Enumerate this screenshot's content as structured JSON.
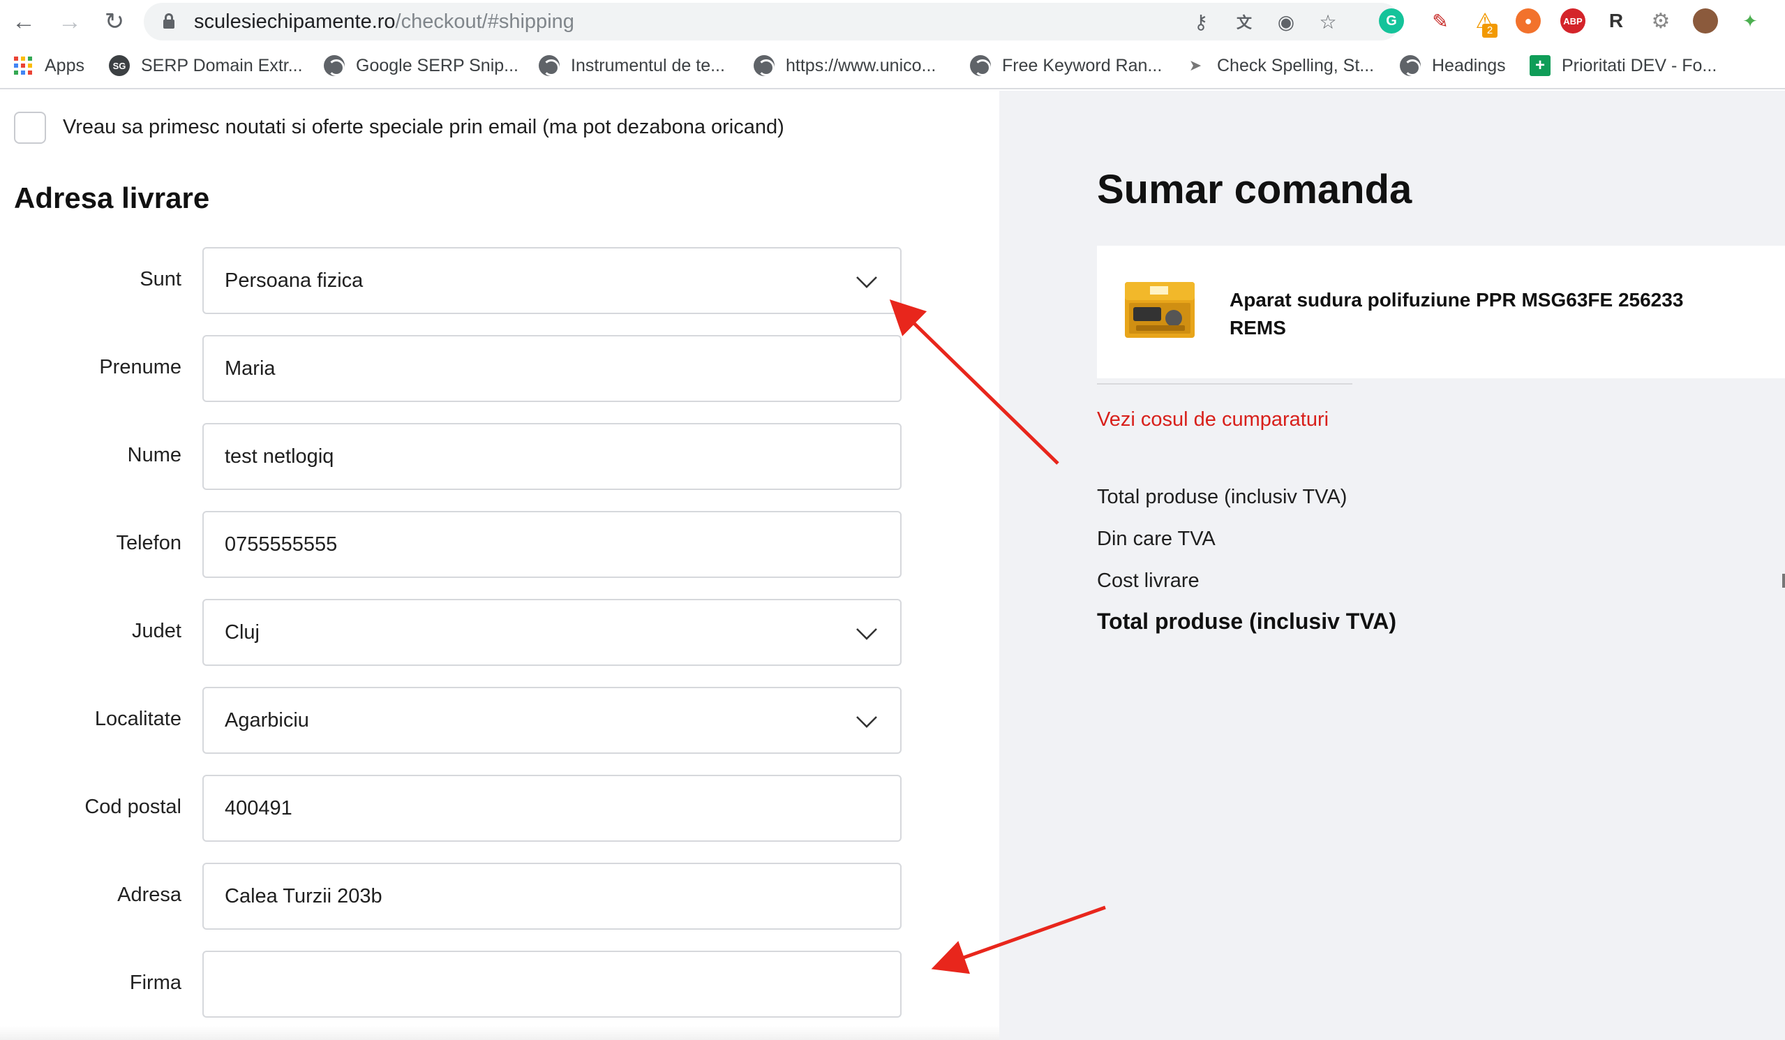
{
  "browser": {
    "url_host": "sculesiechipamente.ro",
    "url_path": "/checkout/#shipping",
    "extension_badge_count": "2",
    "extension_labels": {
      "abp": "ABP",
      "r": "R"
    },
    "bookmarks": [
      {
        "label": "Apps",
        "icon": "apps-grid-icon"
      },
      {
        "label": "SERP Domain Extr...",
        "icon": "sg-icon",
        "icon_text": "SG"
      },
      {
        "label": "Google SERP Snip...",
        "icon": "globe-icon"
      },
      {
        "label": "Instrumentul de te...",
        "icon": "globe-icon"
      },
      {
        "label": "https://www.unico...",
        "icon": "globe-icon"
      },
      {
        "label": "Free Keyword Ran...",
        "icon": "globe-icon"
      },
      {
        "label": "Check Spelling, St...",
        "icon": "pin-icon"
      },
      {
        "label": "Headings",
        "icon": "globe-icon"
      },
      {
        "label": "Prioritati DEV - Fo...",
        "icon": "sheets-icon"
      }
    ]
  },
  "checkout": {
    "newsletter_label": "Vreau sa primesc noutati si oferte speciale prin email (ma pot dezabona oricand)",
    "newsletter_checked": false,
    "section_title": "Adresa livrare",
    "fields": {
      "sunt": {
        "label": "Sunt",
        "value": "Persoana fizica"
      },
      "prenume": {
        "label": "Prenume",
        "value": "Maria"
      },
      "nume": {
        "label": "Nume",
        "value": "test netlogiq"
      },
      "telefon": {
        "label": "Telefon",
        "value": "0755555555"
      },
      "judet": {
        "label": "Judet",
        "value": "Cluj"
      },
      "localitate": {
        "label": "Localitate",
        "value": "Agarbiciu"
      },
      "cod_postal": {
        "label": "Cod postal",
        "value": "400491"
      },
      "adresa": {
        "label": "Adresa",
        "value": "Calea Turzii 203b"
      },
      "firma": {
        "label": "Firma",
        "value": ""
      }
    }
  },
  "summary": {
    "title": "Sumar comanda",
    "product_name": "Aparat sudura polifuziune PPR MSG63FE 256233 REMS",
    "cart_link": "Vezi cosul de cumparaturi",
    "total_products_label": "Total produse (inclusiv TVA)",
    "vat_label": "Din care TVA",
    "shipping_label": "Cost livrare",
    "grand_total_label": "Total produse (inclusiv TVA)"
  },
  "colors": {
    "link_red": "#d8201b",
    "annotation_arrow": "#e8261c",
    "summary_bg": "#f1f2f5"
  }
}
